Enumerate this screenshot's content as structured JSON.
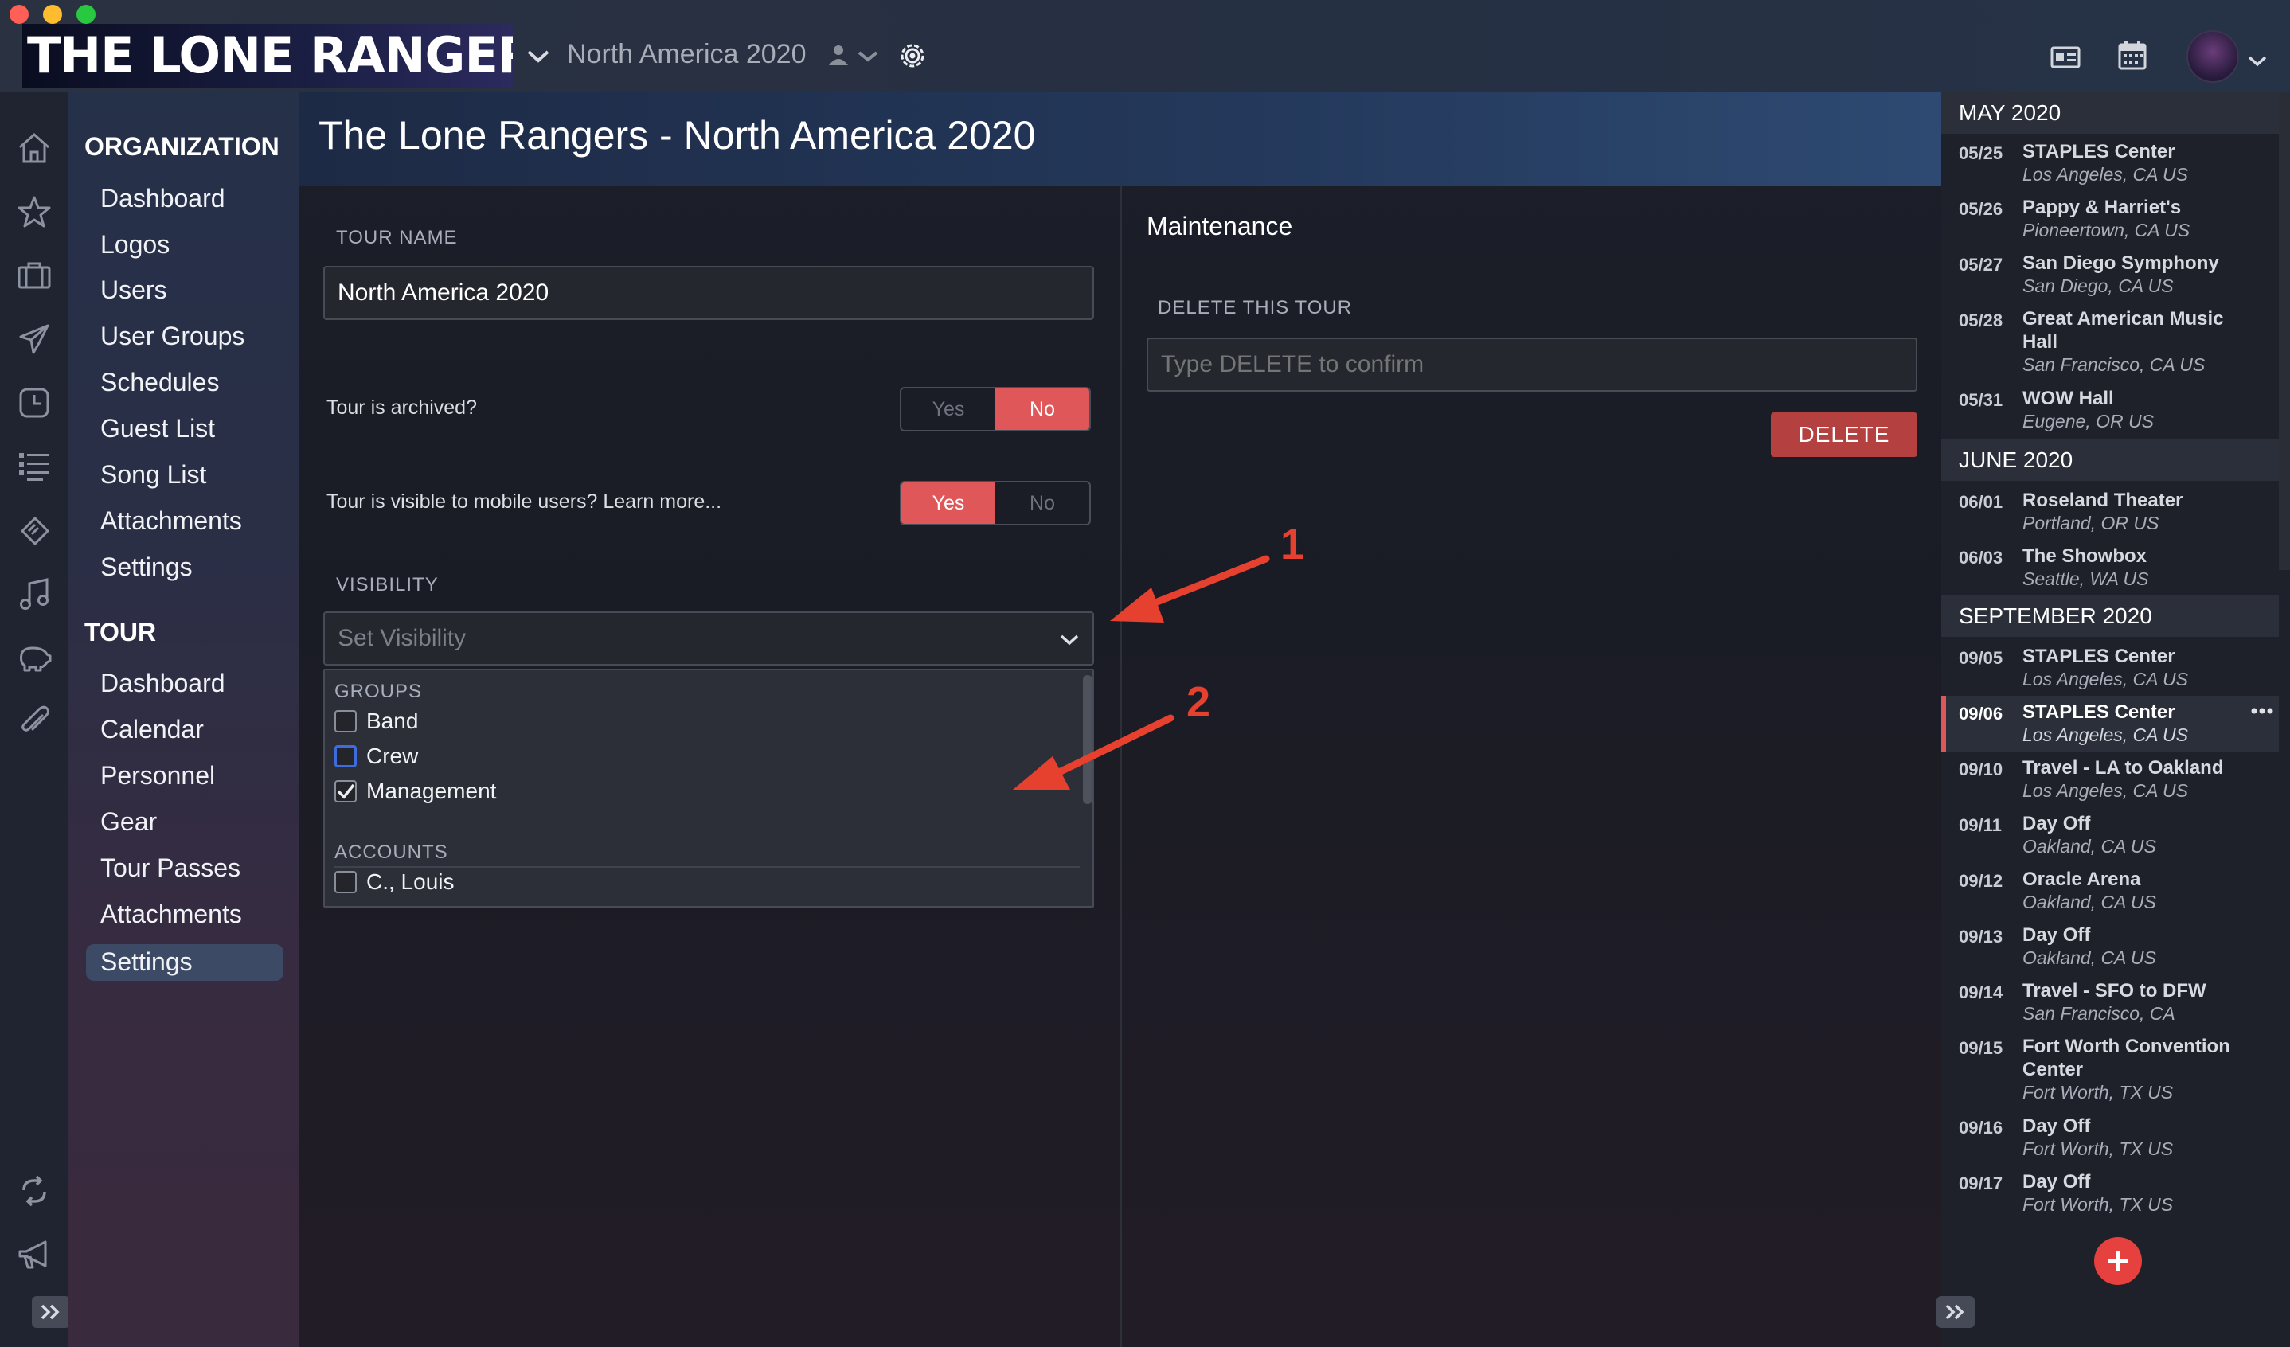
{
  "app": {
    "logo_text": "THE LONE RANGERS",
    "tour_selector": "North America 2020",
    "icons": [
      "chevron-down-icon",
      "user-icon",
      "gear-icon",
      "contact-card-icon",
      "calendar-icon",
      "avatar"
    ]
  },
  "colors": {
    "accent": "#e0575a",
    "annotation": "#e6402e",
    "selected_nav": "#3d4a66"
  },
  "left_icons": [
    "home-icon",
    "star-icon",
    "briefcase-icon",
    "plane-icon",
    "clock-icon",
    "list-icon",
    "ticket-icon",
    "music-icon",
    "piggy-bank-icon",
    "paperclip-icon",
    "sync-icon",
    "megaphone-icon",
    "expand-icon"
  ],
  "nav": {
    "org_heading": "ORGANIZATION",
    "org_items": [
      "Dashboard",
      "Logos",
      "Users",
      "User Groups",
      "Schedules",
      "Guest List",
      "Song List",
      "Attachments",
      "Settings"
    ],
    "tour_heading": "TOUR",
    "tour_items": [
      "Dashboard",
      "Calendar",
      "Personnel",
      "Gear",
      "Tour Passes",
      "Attachments",
      "Settings"
    ],
    "selected": "Settings"
  },
  "header": {
    "title": "The Lone Rangers - North America 2020"
  },
  "settings": {
    "tour_name_label": "TOUR NAME",
    "tour_name_value": "North America 2020",
    "archived_question": "Tour is archived?",
    "archived_yes": "Yes",
    "archived_no": "No",
    "archived_value": "No",
    "visible_question": "Tour is visible to mobile users?",
    "learn_more": "Learn more...",
    "visible_yes": "Yes",
    "visible_no": "No",
    "visible_value": "Yes",
    "visibility_label": "VISIBILITY",
    "visibility_placeholder": "Set Visibility",
    "groups_heading": "GROUPS",
    "groups": [
      {
        "label": "Band",
        "checked": false
      },
      {
        "label": "Crew",
        "checked": false
      },
      {
        "label": "Management",
        "checked": true
      }
    ],
    "accounts_heading": "ACCOUNTS",
    "accounts": [
      {
        "label": "C., Louis",
        "checked": false
      }
    ]
  },
  "maintenance": {
    "title": "Maintenance",
    "delete_label": "DELETE THIS TOUR",
    "delete_placeholder": "Type DELETE to confirm",
    "delete_button": "DELETE"
  },
  "annotations": [
    "1",
    "2"
  ],
  "schedule": {
    "months": [
      {
        "label": "MAY 2020",
        "events": [
          {
            "date": "05/25",
            "name": "STAPLES Center",
            "location": "Los Angeles, CA US"
          },
          {
            "date": "05/26",
            "name": "Pappy & Harriet's",
            "location": "Pioneertown, CA US"
          },
          {
            "date": "05/27",
            "name": "San Diego Symphony",
            "location": "San Diego, CA US"
          },
          {
            "date": "05/28",
            "name": "Great American Music Hall",
            "location": "San Francisco, CA US"
          },
          {
            "date": "05/31",
            "name": "WOW Hall",
            "location": "Eugene, OR US"
          }
        ]
      },
      {
        "label": "JUNE 2020",
        "events": [
          {
            "date": "06/01",
            "name": "Roseland Theater",
            "location": "Portland, OR US"
          },
          {
            "date": "06/03",
            "name": "The Showbox",
            "location": "Seattle, WA US"
          }
        ]
      },
      {
        "label": "SEPTEMBER 2020",
        "events": [
          {
            "date": "09/05",
            "name": "STAPLES Center",
            "location": "Los Angeles, CA US"
          },
          {
            "date": "09/06",
            "name": "STAPLES Center",
            "location": "Los Angeles, CA US",
            "selected": true
          },
          {
            "date": "09/10",
            "name": "Travel - LA to Oakland",
            "location": "Los Angeles, CA US"
          },
          {
            "date": "09/11",
            "name": "Day Off",
            "location": "Oakland, CA US"
          },
          {
            "date": "09/12",
            "name": "Oracle Arena",
            "location": "Oakland, CA US"
          },
          {
            "date": "09/13",
            "name": "Day Off",
            "location": "Oakland, CA US"
          },
          {
            "date": "09/14",
            "name": "Travel - SFO to DFW",
            "location": "San Francisco, CA"
          },
          {
            "date": "09/15",
            "name": "Fort Worth Convention Center",
            "location": "Fort Worth, TX US"
          },
          {
            "date": "09/16",
            "name": "Day Off",
            "location": "Fort Worth, TX US"
          },
          {
            "date": "09/17",
            "name": "Day Off",
            "location": "Fort Worth, TX US"
          }
        ]
      }
    ],
    "more_icon": "more-icon",
    "add_icon": "add-icon"
  }
}
